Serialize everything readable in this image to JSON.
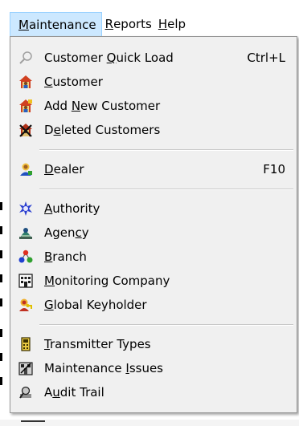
{
  "menubar": {
    "items": [
      {
        "label_pre": "",
        "mnemonic": "M",
        "label_post": "aintenance",
        "active": true
      },
      {
        "label_pre": "",
        "mnemonic": "R",
        "label_post": "eports",
        "active": false
      },
      {
        "label_pre": "",
        "mnemonic": "H",
        "label_post": "elp",
        "active": false
      }
    ]
  },
  "menu": {
    "items": [
      {
        "pre": "Customer ",
        "mn": "Q",
        "post": "uick Load",
        "shortcut": "Ctrl+L",
        "icon": "magnifier-icon"
      },
      {
        "pre": "",
        "mn": "C",
        "post": "ustomer",
        "shortcut": "",
        "icon": "customer-house-icon"
      },
      {
        "pre": "Add ",
        "mn": "N",
        "post": "ew Customer",
        "shortcut": "",
        "icon": "add-customer-icon"
      },
      {
        "pre": "D",
        "mn": "e",
        "post": "leted Customers",
        "shortcut": "",
        "icon": "deleted-customers-icon"
      },
      {
        "pre": "",
        "mn": "D",
        "post": "ealer",
        "shortcut": "F10",
        "icon": "dealer-icon"
      },
      {
        "pre": "",
        "mn": "A",
        "post": "uthority",
        "shortcut": "",
        "icon": "authority-icon"
      },
      {
        "pre": "Agen",
        "mn": "c",
        "post": "y",
        "shortcut": "",
        "icon": "agency-icon"
      },
      {
        "pre": "",
        "mn": "B",
        "post": "ranch",
        "shortcut": "",
        "icon": "branch-icon"
      },
      {
        "pre": "",
        "mn": "M",
        "post": "onitoring Company",
        "shortcut": "",
        "icon": "monitoring-company-icon"
      },
      {
        "pre": "",
        "mn": "G",
        "post": "lobal Keyholder",
        "shortcut": "",
        "icon": "keyholder-icon"
      },
      {
        "pre": "",
        "mn": "T",
        "post": "ransmitter Types",
        "shortcut": "",
        "icon": "transmitter-icon"
      },
      {
        "pre": "Maintenance ",
        "mn": "I",
        "post": "ssues",
        "shortcut": "",
        "icon": "maintenance-issues-icon"
      },
      {
        "pre": "A",
        "mn": "u",
        "post": "dit Trail",
        "shortcut": "",
        "icon": "audit-trail-icon"
      }
    ]
  },
  "colors": {
    "menu_background": "#f0f0f0",
    "menubar_active": "#cce8ff",
    "separator": "#c8c8c8"
  }
}
